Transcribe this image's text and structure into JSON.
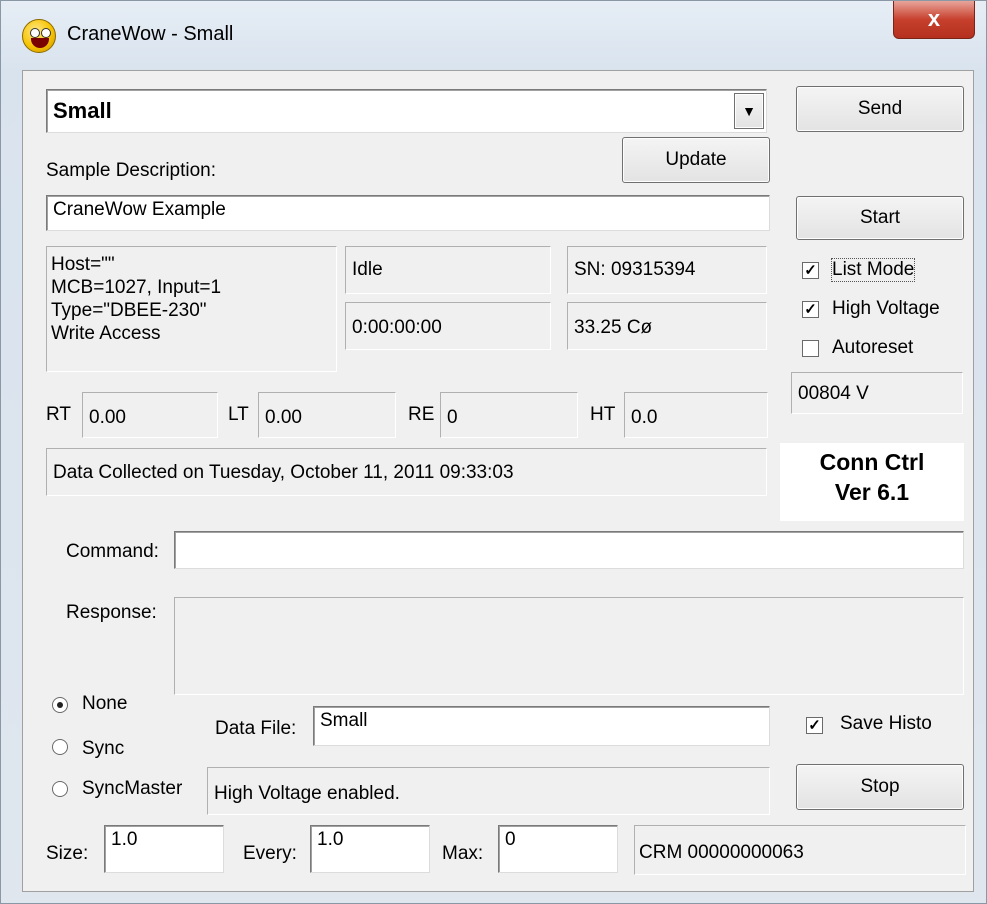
{
  "window": {
    "title": "CraneWow - Small",
    "close_glyph": "x"
  },
  "sample": {
    "selected": "Small",
    "description_label": "Sample Description:",
    "description": "CraneWow Example"
  },
  "buttons": {
    "send": "Send",
    "update": "Update",
    "start": "Start",
    "stop": "Stop"
  },
  "host_info": [
    "Host=\"\"",
    "MCB=1027, Input=1",
    "Type=\"DBEE-230\"",
    "Write Access"
  ],
  "status": {
    "state": "Idle",
    "elapsed": "0:00:00:00",
    "serial": "SN: 09315394",
    "temperature": "33.25 Cø"
  },
  "options": {
    "list_mode": "List Mode",
    "high_voltage": "High Voltage",
    "autoreset": "Autoreset",
    "save_histo": "Save Histo"
  },
  "options_state": {
    "list_mode": true,
    "high_voltage": true,
    "autoreset": false,
    "save_histo": true
  },
  "voltage": "00804 V",
  "times": [
    {
      "label": "RT",
      "value": "0.00"
    },
    {
      "label": "LT",
      "value": "0.00"
    },
    {
      "label": "RE",
      "value": "0"
    },
    {
      "label": "HT",
      "value": "0.0"
    }
  ],
  "data_collected": "Data Collected on Tuesday, October 11, 2011 09:33:03",
  "conn_ctrl": {
    "line1": "Conn Ctrl",
    "line2": "Ver 6.1"
  },
  "command": {
    "label": "Command:",
    "value": ""
  },
  "response": {
    "label": "Response:",
    "value": ""
  },
  "sync_mode": {
    "options": [
      "None",
      "Sync",
      "SyncMaster"
    ],
    "selected": "None"
  },
  "data_file": {
    "label": "Data File:",
    "value": "Small"
  },
  "message": "High Voltage enabled.",
  "size": {
    "label": "Size:",
    "value": "1.0"
  },
  "every": {
    "label": "Every:",
    "value": "1.0"
  },
  "max": {
    "label": "Max:",
    "value": "0"
  },
  "crm": "CRM 00000000063",
  "colors": {
    "close_button": "#c7402e",
    "window_frame": "#d9e3ee",
    "panel_bg": "#f0f0f0"
  }
}
